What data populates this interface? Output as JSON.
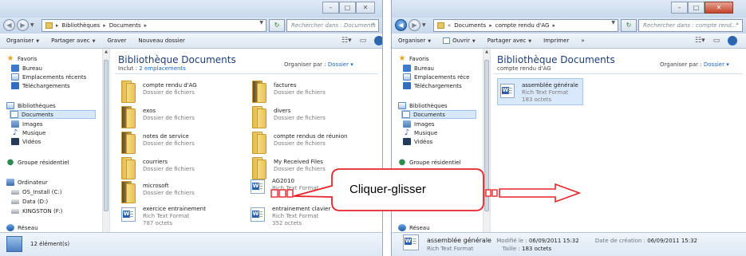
{
  "left_window": {
    "nav": {
      "back": "◀",
      "forward": "▶"
    },
    "address": {
      "sep": "▸",
      "crumbs": [
        "Bibliothèques",
        "Documents"
      ]
    },
    "search_placeholder": "Rechercher dans : Documents",
    "toolbar": {
      "organize": "Organiser",
      "share": "Partager avec",
      "burn": "Graver",
      "new_folder": "Nouveau dossier"
    },
    "sidebar": {
      "favorites": "Favoris",
      "desktop": "Bureau",
      "recent": "Emplacements récents",
      "downloads": "Téléchargements",
      "libraries": "Bibliothèques",
      "documents": "Documents",
      "images": "Images",
      "music": "Musique",
      "videos": "Vidéos",
      "homegroup": "Groupe résidentiel",
      "computer": "Ordinateur",
      "drive_c": "OS_Install (C:)",
      "drive_d": "Data (D:)",
      "drive_f": "KINGSTON (F:)",
      "network": "Réseau"
    },
    "main": {
      "title": "Bibliothèque Documents",
      "includes_prefix": "Inclut :",
      "includes_link": "2 emplacements",
      "arrange_label": "Organiser par :",
      "arrange_value": "Dossier",
      "files": [
        {
          "name": "compte rendu d'AG",
          "type": "Dossier de fichiers"
        },
        {
          "name": "factures",
          "type": "Dossier de fichiers"
        },
        {
          "name": "exos",
          "type": "Dossier de fichiers"
        },
        {
          "name": "divers",
          "type": "Dossier de fichiers"
        },
        {
          "name": "notes de service",
          "type": "Dossier de fichiers"
        },
        {
          "name": "compte rendus de réunion",
          "type": "Dossier de fichiers"
        },
        {
          "name": "courriers",
          "type": "Dossier de fichiers"
        },
        {
          "name": "My Received Files",
          "type": "Dossier de fichiers"
        },
        {
          "name": "microsoft",
          "type": "Dossier de fichiers"
        },
        {
          "name": "AG2010",
          "type": "Rich Text Format",
          "size": "octets"
        },
        {
          "name": "exercice entrainement",
          "type": "Rich Text Format",
          "size": "787 octets"
        },
        {
          "name": "entrainement clavier",
          "type": "Rich Text Format",
          "size": "352 octets"
        }
      ]
    },
    "status": "12 élément(s)"
  },
  "right_window": {
    "nav": {
      "back": "◀",
      "forward": "▶"
    },
    "address": {
      "prefix": "«",
      "sep": "▸",
      "crumbs": [
        "Documents",
        "compte rendu d'AG"
      ]
    },
    "search_placeholder": "Rechercher dans : compte rend...",
    "toolbar": {
      "organize": "Organiser",
      "open": "Ouvrir",
      "share": "Partager avec",
      "print": "Imprimer",
      "more": "»"
    },
    "sidebar": {
      "favorites": "Favoris",
      "desktop": "Bureau",
      "recent": "Emplacements réce",
      "downloads": "Téléchargements",
      "libraries": "Bibliothèques",
      "documents": "Documents",
      "images": "Images",
      "music": "Musique",
      "videos": "Vidéos",
      "homegroup": "Groupe résidentiel",
      "drive_f": "KINGSTON (F:)",
      "network": "Réseau"
    },
    "main": {
      "title": "Bibliothèque Documents",
      "subtitle": "compte rendu d'AG",
      "arrange_label": "Organiser par :",
      "arrange_value": "Dossier",
      "file": {
        "name": "assemblée générale",
        "type": "Rich Text Format",
        "size": "183 octets"
      }
    },
    "details": {
      "name": "assemblée générale",
      "type": "Rich Text Format",
      "modified_label": "Modifié le :",
      "modified": "06/09/2011 15:32",
      "created_label": "Date de création :",
      "created": "06/09/2011 15:32",
      "size_label": "Taille :",
      "size": "183 octets"
    }
  },
  "callout": {
    "text": "Cliquer-glisser"
  },
  "colors": {
    "callout_red": "#e8242b",
    "title_blue": "#1e3d78",
    "link_blue": "#1a66c4"
  }
}
